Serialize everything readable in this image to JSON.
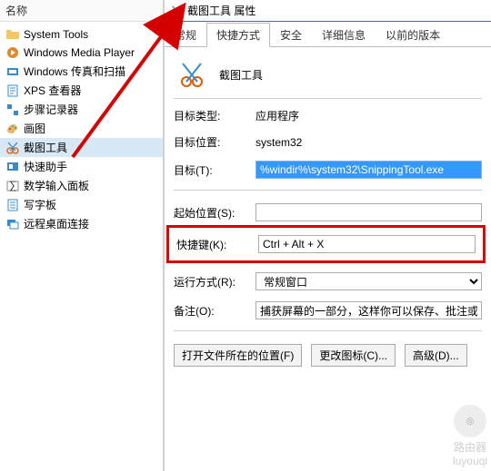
{
  "left": {
    "header": "名称",
    "items": [
      {
        "label": "System Tools",
        "icon": "folder"
      },
      {
        "label": "Windows Media Player",
        "icon": "wmp"
      },
      {
        "label": "Windows 传真和扫描",
        "icon": "fax"
      },
      {
        "label": "XPS 查看器",
        "icon": "xps"
      },
      {
        "label": "步骤记录器",
        "icon": "steps"
      },
      {
        "label": "画图",
        "icon": "paint"
      },
      {
        "label": "截图工具",
        "icon": "snip",
        "selected": true
      },
      {
        "label": "快速助手",
        "icon": "assist"
      },
      {
        "label": "数学输入面板",
        "icon": "math"
      },
      {
        "label": "写字板",
        "icon": "wordpad"
      },
      {
        "label": "远程桌面连接",
        "icon": "rdp"
      }
    ]
  },
  "props": {
    "title": "截图工具 属性",
    "tabs": [
      {
        "label": "常规"
      },
      {
        "label": "快捷方式",
        "active": true
      },
      {
        "label": "安全"
      },
      {
        "label": "详细信息"
      },
      {
        "label": "以前的版本"
      }
    ],
    "app_name": "截图工具",
    "rows": {
      "target_type_label": "目标类型:",
      "target_type_value": "应用程序",
      "target_loc_label": "目标位置:",
      "target_loc_value": "system32",
      "target_label": "目标(T):",
      "target_value": "%windir%\\system32\\SnippingTool.exe",
      "start_in_label": "起始位置(S):",
      "start_in_value": "",
      "shortcut_label": "快捷键(K):",
      "shortcut_value": "Ctrl + Alt + X",
      "run_label": "运行方式(R):",
      "run_value": "常规窗口",
      "comment_label": "备注(O):",
      "comment_value": "捕获屏幕的一部分，这样你可以保存、批注或"
    },
    "buttons": {
      "open_loc": "打开文件所在的位置(F)",
      "change_icon": "更改图标(C)...",
      "advanced": "高级(D)..."
    }
  },
  "watermark": {
    "brand": "路由器",
    "domain": "luyouqi"
  }
}
